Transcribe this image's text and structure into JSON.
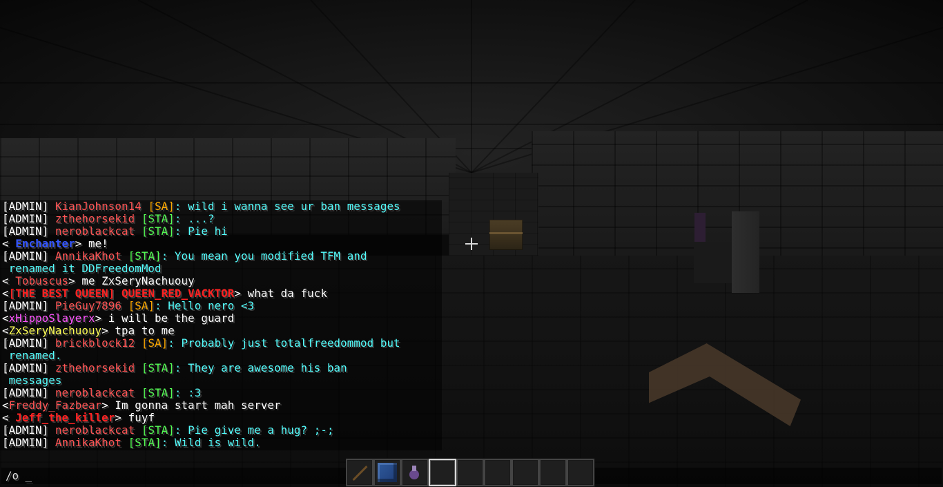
{
  "chat": {
    "lines": [
      [
        {
          "t": "[ADMIN] ",
          "c": "#ffffff"
        },
        {
          "t": "KianJohnson14",
          "c": "#ff5555"
        },
        {
          "t": " ",
          "c": "#ffffff"
        },
        {
          "t": "[SA]",
          "c": "#ffaa00"
        },
        {
          "t": ": wild i wanna see ur ban messages",
          "c": "#55ffff"
        }
      ],
      [
        {
          "t": "[ADMIN] ",
          "c": "#ffffff"
        },
        {
          "t": "zthehorsekid",
          "c": "#ff5555"
        },
        {
          "t": " ",
          "c": "#ffffff"
        },
        {
          "t": "[STA]",
          "c": "#55ff55"
        },
        {
          "t": ": ...?",
          "c": "#55ffff"
        }
      ],
      [
        {
          "t": "[ADMIN] ",
          "c": "#ffffff"
        },
        {
          "t": "neroblackcat",
          "c": "#ff5555"
        },
        {
          "t": " ",
          "c": "#ffffff"
        },
        {
          "t": "[STA]",
          "c": "#55ff55"
        },
        {
          "t": ": Pie hi",
          "c": "#55ffff"
        }
      ],
      [
        {
          "t": "< ",
          "c": "#ffffff"
        },
        {
          "t": "Enchanter",
          "c": "#3355ff",
          "b": true
        },
        {
          "t": "> me!",
          "c": "#ffffff"
        }
      ],
      [
        {
          "t": "[ADMIN] ",
          "c": "#ffffff"
        },
        {
          "t": "AnnikaKhot",
          "c": "#ff5555"
        },
        {
          "t": " ",
          "c": "#ffffff"
        },
        {
          "t": "[STA]",
          "c": "#55ff55"
        },
        {
          "t": ": You mean you modified TFM and",
          "c": "#55ffff"
        }
      ],
      [
        {
          "t": " renamed it DDFreedomMod",
          "c": "#55ffff"
        }
      ],
      [
        {
          "t": "< ",
          "c": "#ffffff"
        },
        {
          "t": "Tobuscus",
          "c": "#ff5555"
        },
        {
          "t": "> me ZxSeryNachuouy",
          "c": "#ffffff"
        }
      ],
      [
        {
          "t": "<",
          "c": "#ffffff"
        },
        {
          "t": "[THE BEST QUEEN] QUEEN_RED_VACKTOR",
          "c": "#ff2222",
          "b": true
        },
        {
          "t": "> what da fuck",
          "c": "#ffffff"
        }
      ],
      [
        {
          "t": "[ADMIN] ",
          "c": "#ffffff"
        },
        {
          "t": "PieGuy7896",
          "c": "#ff5555"
        },
        {
          "t": " ",
          "c": "#ffffff"
        },
        {
          "t": "[SA]",
          "c": "#ffaa00"
        },
        {
          "t": ": Hello nero <3",
          "c": "#55ffff"
        }
      ],
      [
        {
          "t": "<",
          "c": "#ffffff"
        },
        {
          "t": "xHippoSlayerx",
          "c": "#ff55ff"
        },
        {
          "t": "> i will be the guard",
          "c": "#ffffff"
        }
      ],
      [
        {
          "t": "<",
          "c": "#ffffff"
        },
        {
          "t": "ZxSeryNachuouy",
          "c": "#ffff55"
        },
        {
          "t": "> tpa to me",
          "c": "#ffffff"
        }
      ],
      [
        {
          "t": "[ADMIN] ",
          "c": "#ffffff"
        },
        {
          "t": "brickblock12",
          "c": "#ff5555"
        },
        {
          "t": " ",
          "c": "#ffffff"
        },
        {
          "t": "[SA]",
          "c": "#ffaa00"
        },
        {
          "t": ": Probably just totalfreedommod but",
          "c": "#55ffff"
        }
      ],
      [
        {
          "t": " renamed.",
          "c": "#55ffff"
        }
      ],
      [
        {
          "t": "[ADMIN] ",
          "c": "#ffffff"
        },
        {
          "t": "zthehorsekid",
          "c": "#ff5555"
        },
        {
          "t": " ",
          "c": "#ffffff"
        },
        {
          "t": "[STA]",
          "c": "#55ff55"
        },
        {
          "t": ": They are awesome his ban",
          "c": "#55ffff"
        }
      ],
      [
        {
          "t": " messages",
          "c": "#55ffff"
        }
      ],
      [
        {
          "t": "[ADMIN] ",
          "c": "#ffffff"
        },
        {
          "t": "neroblackcat",
          "c": "#ff5555"
        },
        {
          "t": " ",
          "c": "#ffffff"
        },
        {
          "t": "[STA]",
          "c": "#55ff55"
        },
        {
          "t": ": :3",
          "c": "#55ffff"
        }
      ],
      [
        {
          "t": "<",
          "c": "#ffffff"
        },
        {
          "t": "Freddy_Fazbear",
          "c": "#ff5555"
        },
        {
          "t": "> Im gonna start mah server",
          "c": "#ffffff"
        }
      ],
      [
        {
          "t": "< ",
          "c": "#ffffff"
        },
        {
          "t": "Jeff_the_killer",
          "c": "#ff2222",
          "b": true
        },
        {
          "t": "> fuyf",
          "c": "#ffffff"
        }
      ],
      [
        {
          "t": "[ADMIN] ",
          "c": "#ffffff"
        },
        {
          "t": "neroblackcat",
          "c": "#ff5555"
        },
        {
          "t": " ",
          "c": "#ffffff"
        },
        {
          "t": "[STA]",
          "c": "#55ff55"
        },
        {
          "t": ": Pie give me a hug? ;-;",
          "c": "#55ffff"
        }
      ],
      [
        {
          "t": "[ADMIN] ",
          "c": "#ffffff"
        },
        {
          "t": "AnnikaKhot",
          "c": "#ff5555"
        },
        {
          "t": " ",
          "c": "#ffffff"
        },
        {
          "t": "[STA]",
          "c": "#55ff55"
        },
        {
          "t": ": Wild is wild.",
          "c": "#55ffff"
        }
      ]
    ]
  },
  "command_input": {
    "value": "/o _"
  },
  "hotbar": {
    "selected_slot": 3,
    "slots": [
      {
        "icon": "stick-icon"
      },
      {
        "icon": "blue-block-icon"
      },
      {
        "icon": "potion-icon"
      },
      {
        "icon": ""
      },
      {
        "icon": ""
      },
      {
        "icon": ""
      },
      {
        "icon": ""
      },
      {
        "icon": ""
      },
      {
        "icon": ""
      }
    ]
  }
}
